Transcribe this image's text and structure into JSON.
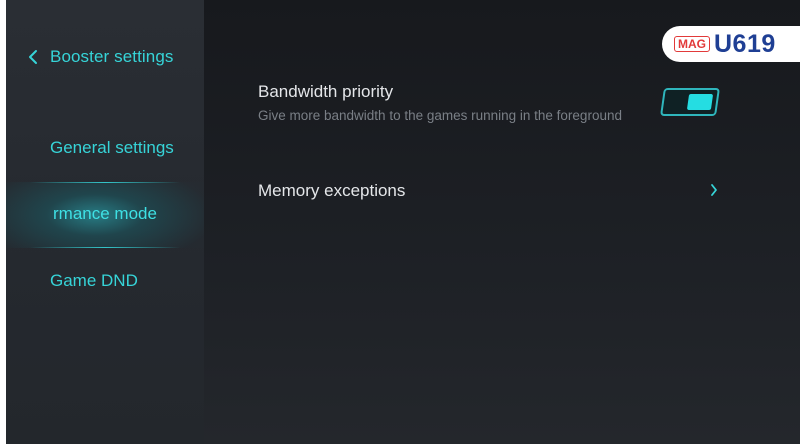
{
  "sidebar": {
    "back_label": "Booster settings",
    "items": [
      {
        "label": "General settings",
        "active": false
      },
      {
        "label": "rmance mode",
        "active": true
      },
      {
        "label": "Game DND",
        "active": false
      }
    ]
  },
  "main": {
    "bandwidth": {
      "title": "Bandwidth priority",
      "subtitle": "Give more bandwidth to the games running in the foreground",
      "toggle_on": true
    },
    "memory": {
      "title": "Memory exceptions"
    }
  },
  "watermark": {
    "tag": "MAG",
    "word": "U619"
  },
  "colors": {
    "accent": "#36d4d8",
    "sidebar_bg": "#2a2e34",
    "main_bg": "#1c1f24",
    "title_text": "#e4e6e9",
    "subtitle_text": "#7a7f86"
  },
  "icons": {
    "back": "chevron-left-icon",
    "memory": "chevron-right-icon"
  }
}
